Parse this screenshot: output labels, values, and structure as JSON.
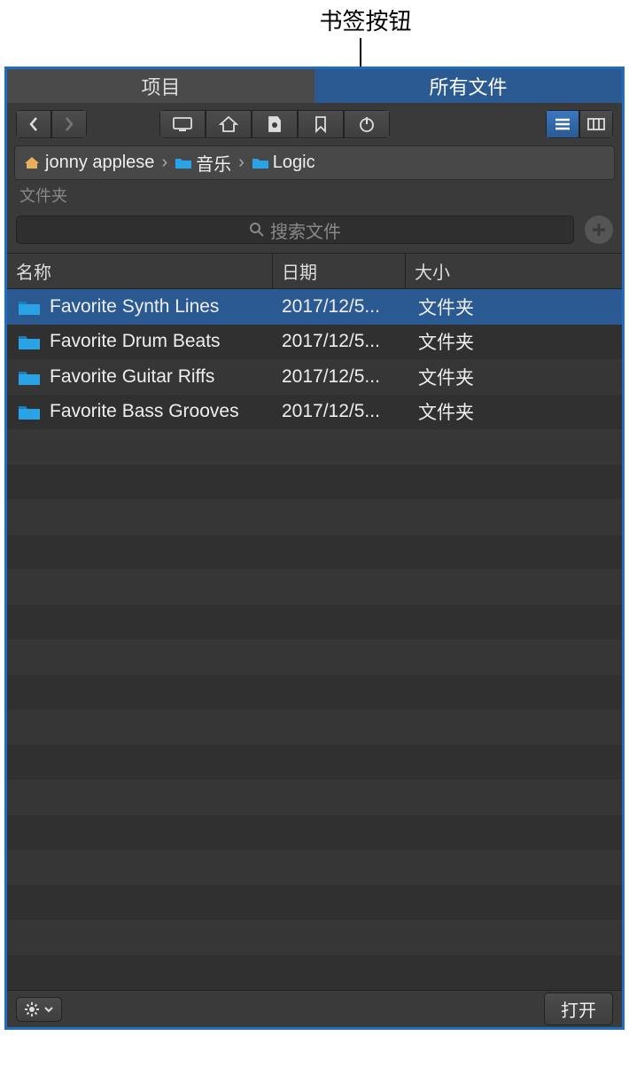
{
  "callout": {
    "label": "书签按钮"
  },
  "tabs": {
    "project": "项目",
    "all_files": "所有文件",
    "active": "all_files"
  },
  "breadcrumb": {
    "items": [
      {
        "label": "jonny applese",
        "icon": "home"
      },
      {
        "label": "音乐",
        "icon": "music-folder"
      },
      {
        "label": "Logic",
        "icon": "folder"
      }
    ]
  },
  "subrow_label": "文件夹",
  "search": {
    "placeholder": "搜索文件"
  },
  "columns": {
    "name": "名称",
    "date": "日期",
    "size": "大小"
  },
  "rows": [
    {
      "name": "Favorite Synth Lines",
      "date": "2017/12/5...",
      "size": "文件夹",
      "selected": true
    },
    {
      "name": "Favorite Drum Beats",
      "date": "2017/12/5...",
      "size": "文件夹",
      "selected": false
    },
    {
      "name": "Favorite Guitar Riffs",
      "date": "2017/12/5...",
      "size": "文件夹",
      "selected": false
    },
    {
      "name": "Favorite Bass Grooves",
      "date": "2017/12/5...",
      "size": "文件夹",
      "selected": false
    }
  ],
  "footer": {
    "open": "打开"
  },
  "colors": {
    "accent": "#2a5a91",
    "folder": "#29a3e6"
  }
}
